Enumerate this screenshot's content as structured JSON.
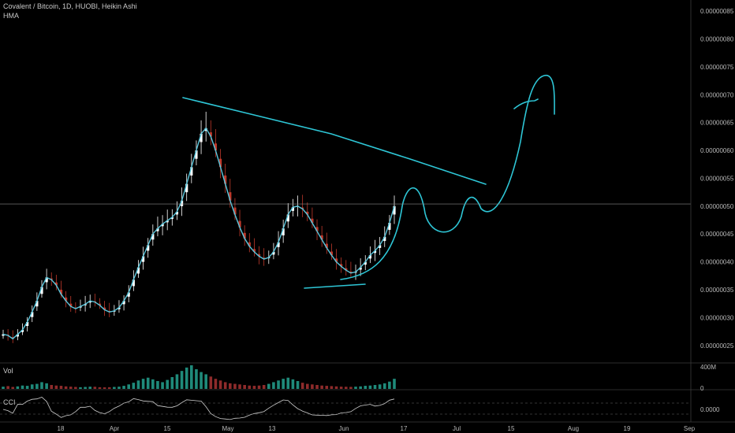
{
  "header": {
    "title": "Covalent / Bitcoin, 1D, HUOBI, Heikin Ashi",
    "indicator": "HMA"
  },
  "panes": {
    "volume_label": "Vol",
    "cci_label": "CCI"
  },
  "colors": {
    "background": "#000000",
    "bull": "#ffffff",
    "bear": "#c0392b",
    "hma": "#5ac8de",
    "drawing": "#2ec6d6",
    "vol_bull": "#1f8a7a",
    "vol_bear": "#8e2b2b",
    "cci": "#d0d0d0"
  },
  "chart_data": [
    {
      "type": "line",
      "title": "Covalent / Bitcoin, 1D, HUOBI, Heikin Ashi",
      "series": [
        {
          "name": "HMA"
        }
      ],
      "x_tick_labels": [
        "18",
        "Apr",
        "15",
        "May",
        "13",
        "Jun",
        "17",
        "Jul",
        "15",
        "Aug",
        "19",
        "Sep"
      ],
      "y_tick_labels": [
        "0.00000025",
        "0.00000030",
        "0.00000035",
        "0.00000040",
        "0.00000045",
        "0.00000050",
        "0.00000055",
        "0.00000060",
        "0.00000065",
        "0.00000070",
        "0.00000075",
        "0.00000080",
        "0.00000085"
      ],
      "ylim": [
        2.2e-07,
        8.7e-07
      ],
      "last_price": 5.04e-07,
      "candle_closes": [
        2.7e-07,
        2.68e-07,
        2.62e-07,
        2.7e-07,
        2.78e-07,
        2.92e-07,
        3.1e-07,
        3.3e-07,
        3.55e-07,
        3.72e-07,
        3.68e-07,
        3.58e-07,
        3.42e-07,
        3.3e-07,
        3.2e-07,
        3.16e-07,
        3.2e-07,
        3.24e-07,
        3.3e-07,
        3.28e-07,
        3.22e-07,
        3.14e-07,
        3.1e-07,
        3.12e-07,
        3.18e-07,
        3.3e-07,
        3.45e-07,
        3.68e-07,
        3.9e-07,
        4.1e-07,
        4.3e-07,
        4.5e-07,
        4.6e-07,
        4.68e-07,
        4.74e-07,
        4.8e-07,
        4.9e-07,
        5.1e-07,
        5.4e-07,
        5.7e-07,
        6e-07,
        6.3e-07,
        6.4e-07,
        6.25e-07,
        6e-07,
        5.7e-07,
        5.4e-07,
        5.1e-07,
        4.85e-07,
        4.62e-07,
        4.42e-07,
        4.28e-07,
        4.18e-07,
        4.1e-07,
        4.05e-07,
        4.08e-07,
        4.18e-07,
        4.35e-07,
        4.6e-07,
        4.85e-07,
        4.98e-07,
        5e-07,
        4.95e-07,
        4.85e-07,
        4.7e-07,
        4.55e-07,
        4.4e-07,
        4.25e-07,
        4.12e-07,
        4e-07,
        3.92e-07,
        3.85e-07,
        3.8e-07,
        3.82e-07,
        3.9e-07,
        4e-07,
        4.12e-07,
        4.2e-07,
        4.3e-07,
        4.45e-07,
        4.7e-07,
        5e-07
      ]
    },
    {
      "type": "bar",
      "title": "Vol",
      "y_tick_labels": [
        "400M",
        "0"
      ],
      "ylim": [
        0,
        480000000
      ],
      "values": [
        40,
        50,
        35,
        45,
        60,
        55,
        80,
        90,
        120,
        100,
        70,
        60,
        55,
        45,
        40,
        35,
        30,
        35,
        40,
        38,
        30,
        28,
        30,
        35,
        40,
        55,
        80,
        110,
        150,
        180,
        200,
        170,
        140,
        120,
        160,
        210,
        260,
        320,
        380,
        420,
        350,
        300,
        260,
        220,
        180,
        150,
        120,
        100,
        90,
        80,
        70,
        60,
        55,
        60,
        70,
        90,
        120,
        150,
        180,
        200,
        170,
        140,
        110,
        90,
        80,
        70,
        60,
        55,
        50,
        45,
        40,
        38,
        36,
        40,
        45,
        55,
        60,
        70,
        80,
        100,
        130,
        180
      ]
    },
    {
      "type": "line",
      "title": "CCI",
      "y_tick_labels": [
        "0.0000"
      ],
      "reference_lines": [
        100,
        -100
      ]
    }
  ]
}
